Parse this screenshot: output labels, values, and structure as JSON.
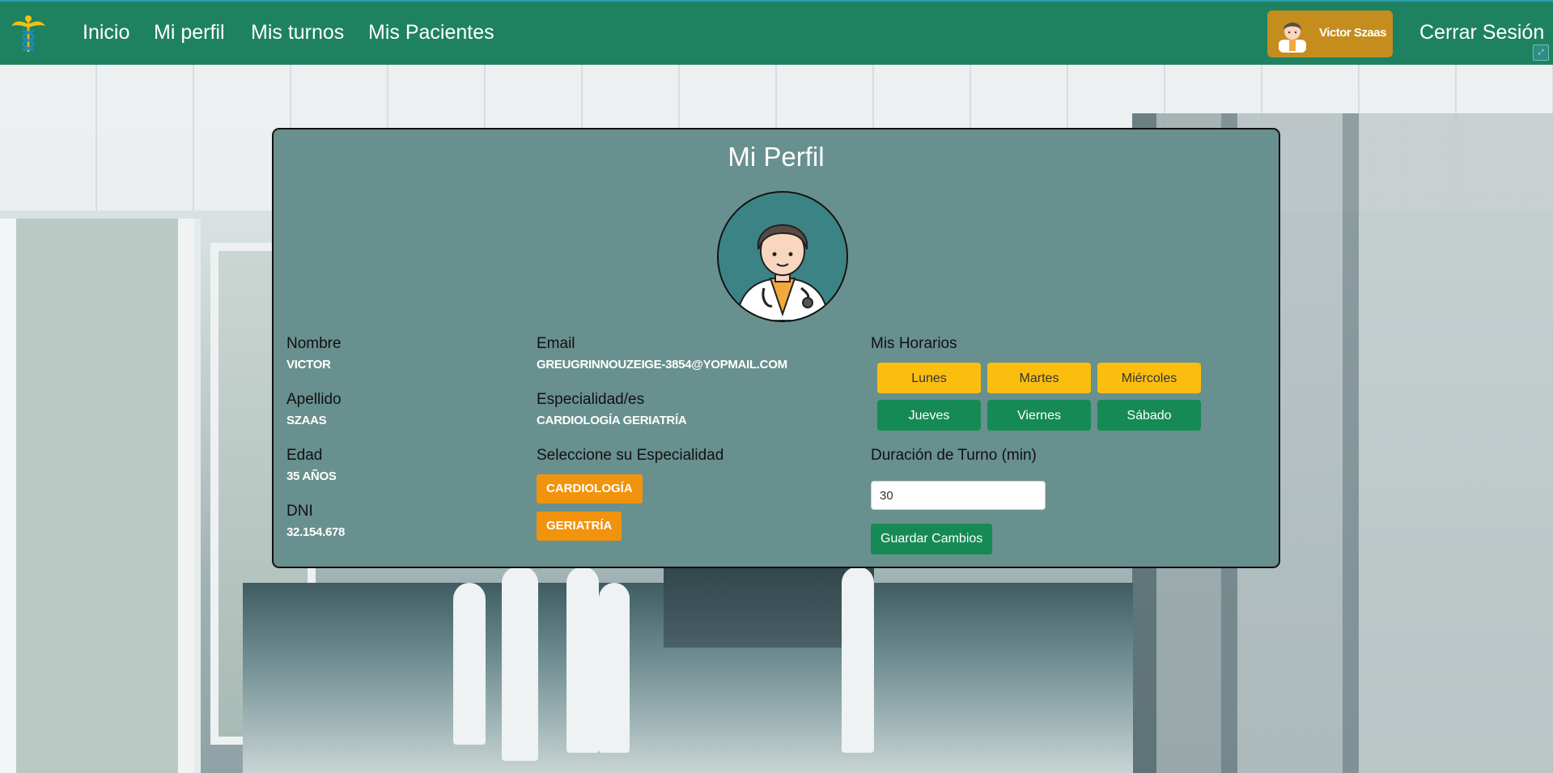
{
  "nav": {
    "links": [
      "Inicio",
      "Mi perfil",
      "Mis turnos",
      "Mis Pacientes"
    ],
    "user_name": "Victor Szaas",
    "logout": "Cerrar Sesión"
  },
  "profile": {
    "title": "Mi Perfil",
    "nombre_label": "Nombre",
    "nombre": "VICTOR",
    "apellido_label": "Apellido",
    "apellido": "SZAAS",
    "edad_label": "Edad",
    "edad": "35 AÑOS",
    "dni_label": "DNI",
    "dni": "32.154.678",
    "email_label": "Email",
    "email": "GREUGRINNOUZEIGE-3854@YOPMAIL.COM",
    "especialidades_label": "Especialidad/es",
    "especialidades": "CARDIOLOGÍA GERIATRÍA",
    "seleccione_label": "Seleccione su Especialidad",
    "specialty_options": [
      "CARDIOLOGÍA",
      "GERIATRÍA"
    ]
  },
  "schedule": {
    "label": "Mis Horarios",
    "days": [
      {
        "name": "Lunes",
        "color": "#fbbe0f"
      },
      {
        "name": "Martes",
        "color": "#fbbe0f"
      },
      {
        "name": "Miércoles",
        "color": "#fbbe0f"
      },
      {
        "name": "Jueves",
        "color": "#168a55"
      },
      {
        "name": "Viernes",
        "color": "#168a55"
      },
      {
        "name": "Sábado",
        "color": "#168a55"
      }
    ],
    "duration_label": "Duración de Turno (min)",
    "duration_value": "30",
    "save_label": "Guardar Cambios"
  }
}
